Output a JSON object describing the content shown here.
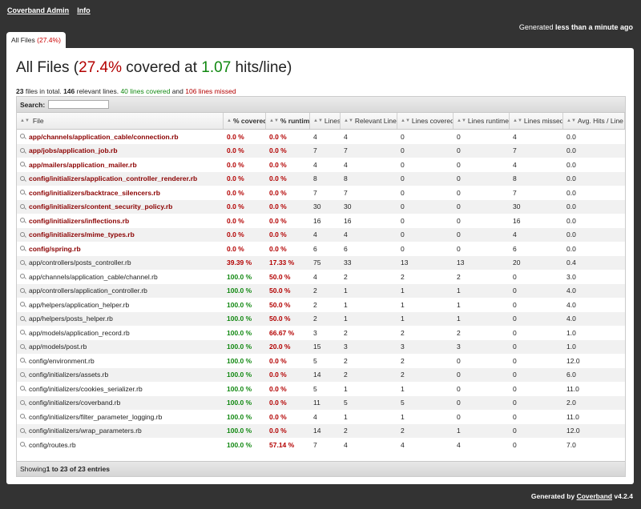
{
  "nav": {
    "brand": "Coverband Admin",
    "info": "Info"
  },
  "generated_top": {
    "prefix": "Generated",
    "when": "less than a minute ago"
  },
  "tab": {
    "label": "All Files",
    "pct": "(27.4%)"
  },
  "title": {
    "prefix": "All Files (",
    "pct": "27.4%",
    "mid": " covered at ",
    "hits": "1.07",
    "suffix": " hits/line)"
  },
  "summary": {
    "files": "23",
    "files_text": " files in total. ",
    "relevant": "146",
    "relevant_text": " relevant lines. ",
    "covered_text": "40 lines covered",
    "and": " and ",
    "missed_text": "106 lines missed"
  },
  "search": {
    "label": "Search:",
    "value": ""
  },
  "columns": [
    "File",
    "% covered",
    "% runtime",
    "Lines",
    "Relevant Lines",
    "Lines covered",
    "Lines runtime",
    "Lines missed",
    "Avg. Hits / Line"
  ],
  "rows": [
    {
      "file": "app/channels/application_cable/connection.rb",
      "cov": "0.0 %",
      "rt": "0.0 %",
      "lines": "4",
      "rel": "4",
      "lc": "0",
      "lr": "0",
      "lm": "4",
      "avg": "0.0",
      "status": "bad"
    },
    {
      "file": "app/jobs/application_job.rb",
      "cov": "0.0 %",
      "rt": "0.0 %",
      "lines": "7",
      "rel": "7",
      "lc": "0",
      "lr": "0",
      "lm": "7",
      "avg": "0.0",
      "status": "bad"
    },
    {
      "file": "app/mailers/application_mailer.rb",
      "cov": "0.0 %",
      "rt": "0.0 %",
      "lines": "4",
      "rel": "4",
      "lc": "0",
      "lr": "0",
      "lm": "4",
      "avg": "0.0",
      "status": "bad"
    },
    {
      "file": "config/initializers/application_controller_renderer.rb",
      "cov": "0.0 %",
      "rt": "0.0 %",
      "lines": "8",
      "rel": "8",
      "lc": "0",
      "lr": "0",
      "lm": "8",
      "avg": "0.0",
      "status": "bad"
    },
    {
      "file": "config/initializers/backtrace_silencers.rb",
      "cov": "0.0 %",
      "rt": "0.0 %",
      "lines": "7",
      "rel": "7",
      "lc": "0",
      "lr": "0",
      "lm": "7",
      "avg": "0.0",
      "status": "bad"
    },
    {
      "file": "config/initializers/content_security_policy.rb",
      "cov": "0.0 %",
      "rt": "0.0 %",
      "lines": "30",
      "rel": "30",
      "lc": "0",
      "lr": "0",
      "lm": "30",
      "avg": "0.0",
      "status": "bad"
    },
    {
      "file": "config/initializers/inflections.rb",
      "cov": "0.0 %",
      "rt": "0.0 %",
      "lines": "16",
      "rel": "16",
      "lc": "0",
      "lr": "0",
      "lm": "16",
      "avg": "0.0",
      "status": "bad"
    },
    {
      "file": "config/initializers/mime_types.rb",
      "cov": "0.0 %",
      "rt": "0.0 %",
      "lines": "4",
      "rel": "4",
      "lc": "0",
      "lr": "0",
      "lm": "4",
      "avg": "0.0",
      "status": "bad"
    },
    {
      "file": "config/spring.rb",
      "cov": "0.0 %",
      "rt": "0.0 %",
      "lines": "6",
      "rel": "6",
      "lc": "0",
      "lr": "0",
      "lm": "6",
      "avg": "0.0",
      "status": "bad"
    },
    {
      "file": "app/controllers/posts_controller.rb",
      "cov": "39.39 %",
      "rt": "17.33 %",
      "lines": "75",
      "rel": "33",
      "lc": "13",
      "lr": "13",
      "lm": "20",
      "avg": "0.4",
      "status": "warn"
    },
    {
      "file": "app/channels/application_cable/channel.rb",
      "cov": "100.0 %",
      "rt": "50.0 %",
      "lines": "4",
      "rel": "2",
      "lc": "2",
      "lr": "2",
      "lm": "0",
      "avg": "3.0",
      "status": "good"
    },
    {
      "file": "app/controllers/application_controller.rb",
      "cov": "100.0 %",
      "rt": "50.0 %",
      "lines": "2",
      "rel": "1",
      "lc": "1",
      "lr": "1",
      "lm": "0",
      "avg": "4.0",
      "status": "good"
    },
    {
      "file": "app/helpers/application_helper.rb",
      "cov": "100.0 %",
      "rt": "50.0 %",
      "lines": "2",
      "rel": "1",
      "lc": "1",
      "lr": "1",
      "lm": "0",
      "avg": "4.0",
      "status": "good"
    },
    {
      "file": "app/helpers/posts_helper.rb",
      "cov": "100.0 %",
      "rt": "50.0 %",
      "lines": "2",
      "rel": "1",
      "lc": "1",
      "lr": "1",
      "lm": "0",
      "avg": "4.0",
      "status": "good"
    },
    {
      "file": "app/models/application_record.rb",
      "cov": "100.0 %",
      "rt": "66.67 %",
      "lines": "3",
      "rel": "2",
      "lc": "2",
      "lr": "2",
      "lm": "0",
      "avg": "1.0",
      "status": "good"
    },
    {
      "file": "app/models/post.rb",
      "cov": "100.0 %",
      "rt": "20.0 %",
      "lines": "15",
      "rel": "3",
      "lc": "3",
      "lr": "3",
      "lm": "0",
      "avg": "1.0",
      "status": "good"
    },
    {
      "file": "config/environment.rb",
      "cov": "100.0 %",
      "rt": "0.0 %",
      "lines": "5",
      "rel": "2",
      "lc": "2",
      "lr": "0",
      "lm": "0",
      "avg": "12.0",
      "status": "good"
    },
    {
      "file": "config/initializers/assets.rb",
      "cov": "100.0 %",
      "rt": "0.0 %",
      "lines": "14",
      "rel": "2",
      "lc": "2",
      "lr": "0",
      "lm": "0",
      "avg": "6.0",
      "status": "good"
    },
    {
      "file": "config/initializers/cookies_serializer.rb",
      "cov": "100.0 %",
      "rt": "0.0 %",
      "lines": "5",
      "rel": "1",
      "lc": "1",
      "lr": "0",
      "lm": "0",
      "avg": "11.0",
      "status": "good"
    },
    {
      "file": "config/initializers/coverband.rb",
      "cov": "100.0 %",
      "rt": "0.0 %",
      "lines": "11",
      "rel": "5",
      "lc": "5",
      "lr": "0",
      "lm": "0",
      "avg": "2.0",
      "status": "good"
    },
    {
      "file": "config/initializers/filter_parameter_logging.rb",
      "cov": "100.0 %",
      "rt": "0.0 %",
      "lines": "4",
      "rel": "1",
      "lc": "1",
      "lr": "0",
      "lm": "0",
      "avg": "11.0",
      "status": "good"
    },
    {
      "file": "config/initializers/wrap_parameters.rb",
      "cov": "100.0 %",
      "rt": "0.0 %",
      "lines": "14",
      "rel": "2",
      "lc": "2",
      "lr": "1",
      "lm": "0",
      "avg": "12.0",
      "status": "good"
    },
    {
      "file": "config/routes.rb",
      "cov": "100.0 %",
      "rt": "57.14 %",
      "lines": "7",
      "rel": "4",
      "lc": "4",
      "lr": "4",
      "lm": "0",
      "avg": "7.0",
      "status": "good"
    }
  ],
  "footer_info": {
    "prefix": "Showing ",
    "range": "1 to 23 of 23 entries"
  },
  "footer": {
    "prefix": "Generated by ",
    "link": "Coverband",
    "version": " v4.2.4"
  },
  "colors": {
    "bad": "#b30000",
    "good": "#118811",
    "background": "#333333"
  }
}
